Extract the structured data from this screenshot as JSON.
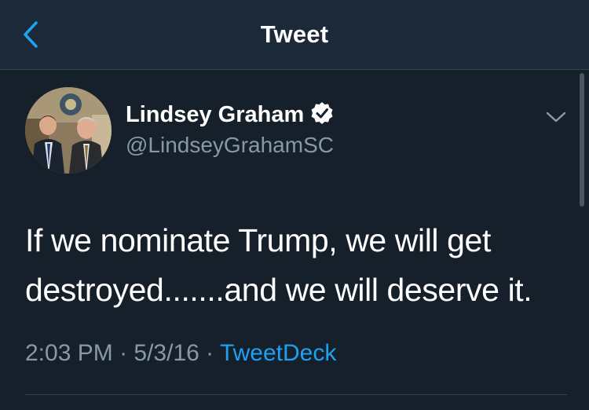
{
  "navbar": {
    "title": "Tweet",
    "back_icon": "chevron-left-icon"
  },
  "tweet": {
    "author": {
      "display_name": "Lindsey Graham",
      "handle": "@LindseyGrahamSC",
      "verified_icon": "verified-badge-icon"
    },
    "text": "If we nominate Trump, we will get destroyed.......and we will deserve it.",
    "time": "2:03 PM",
    "date": "5/3/16",
    "separator": " · ",
    "source": "TweetDeck",
    "caret_icon": "chevron-down-icon"
  },
  "colors": {
    "background": "#15202b",
    "navbar": "#1c2938",
    "accent": "#1da1f2",
    "secondary_text": "#8899a6"
  }
}
